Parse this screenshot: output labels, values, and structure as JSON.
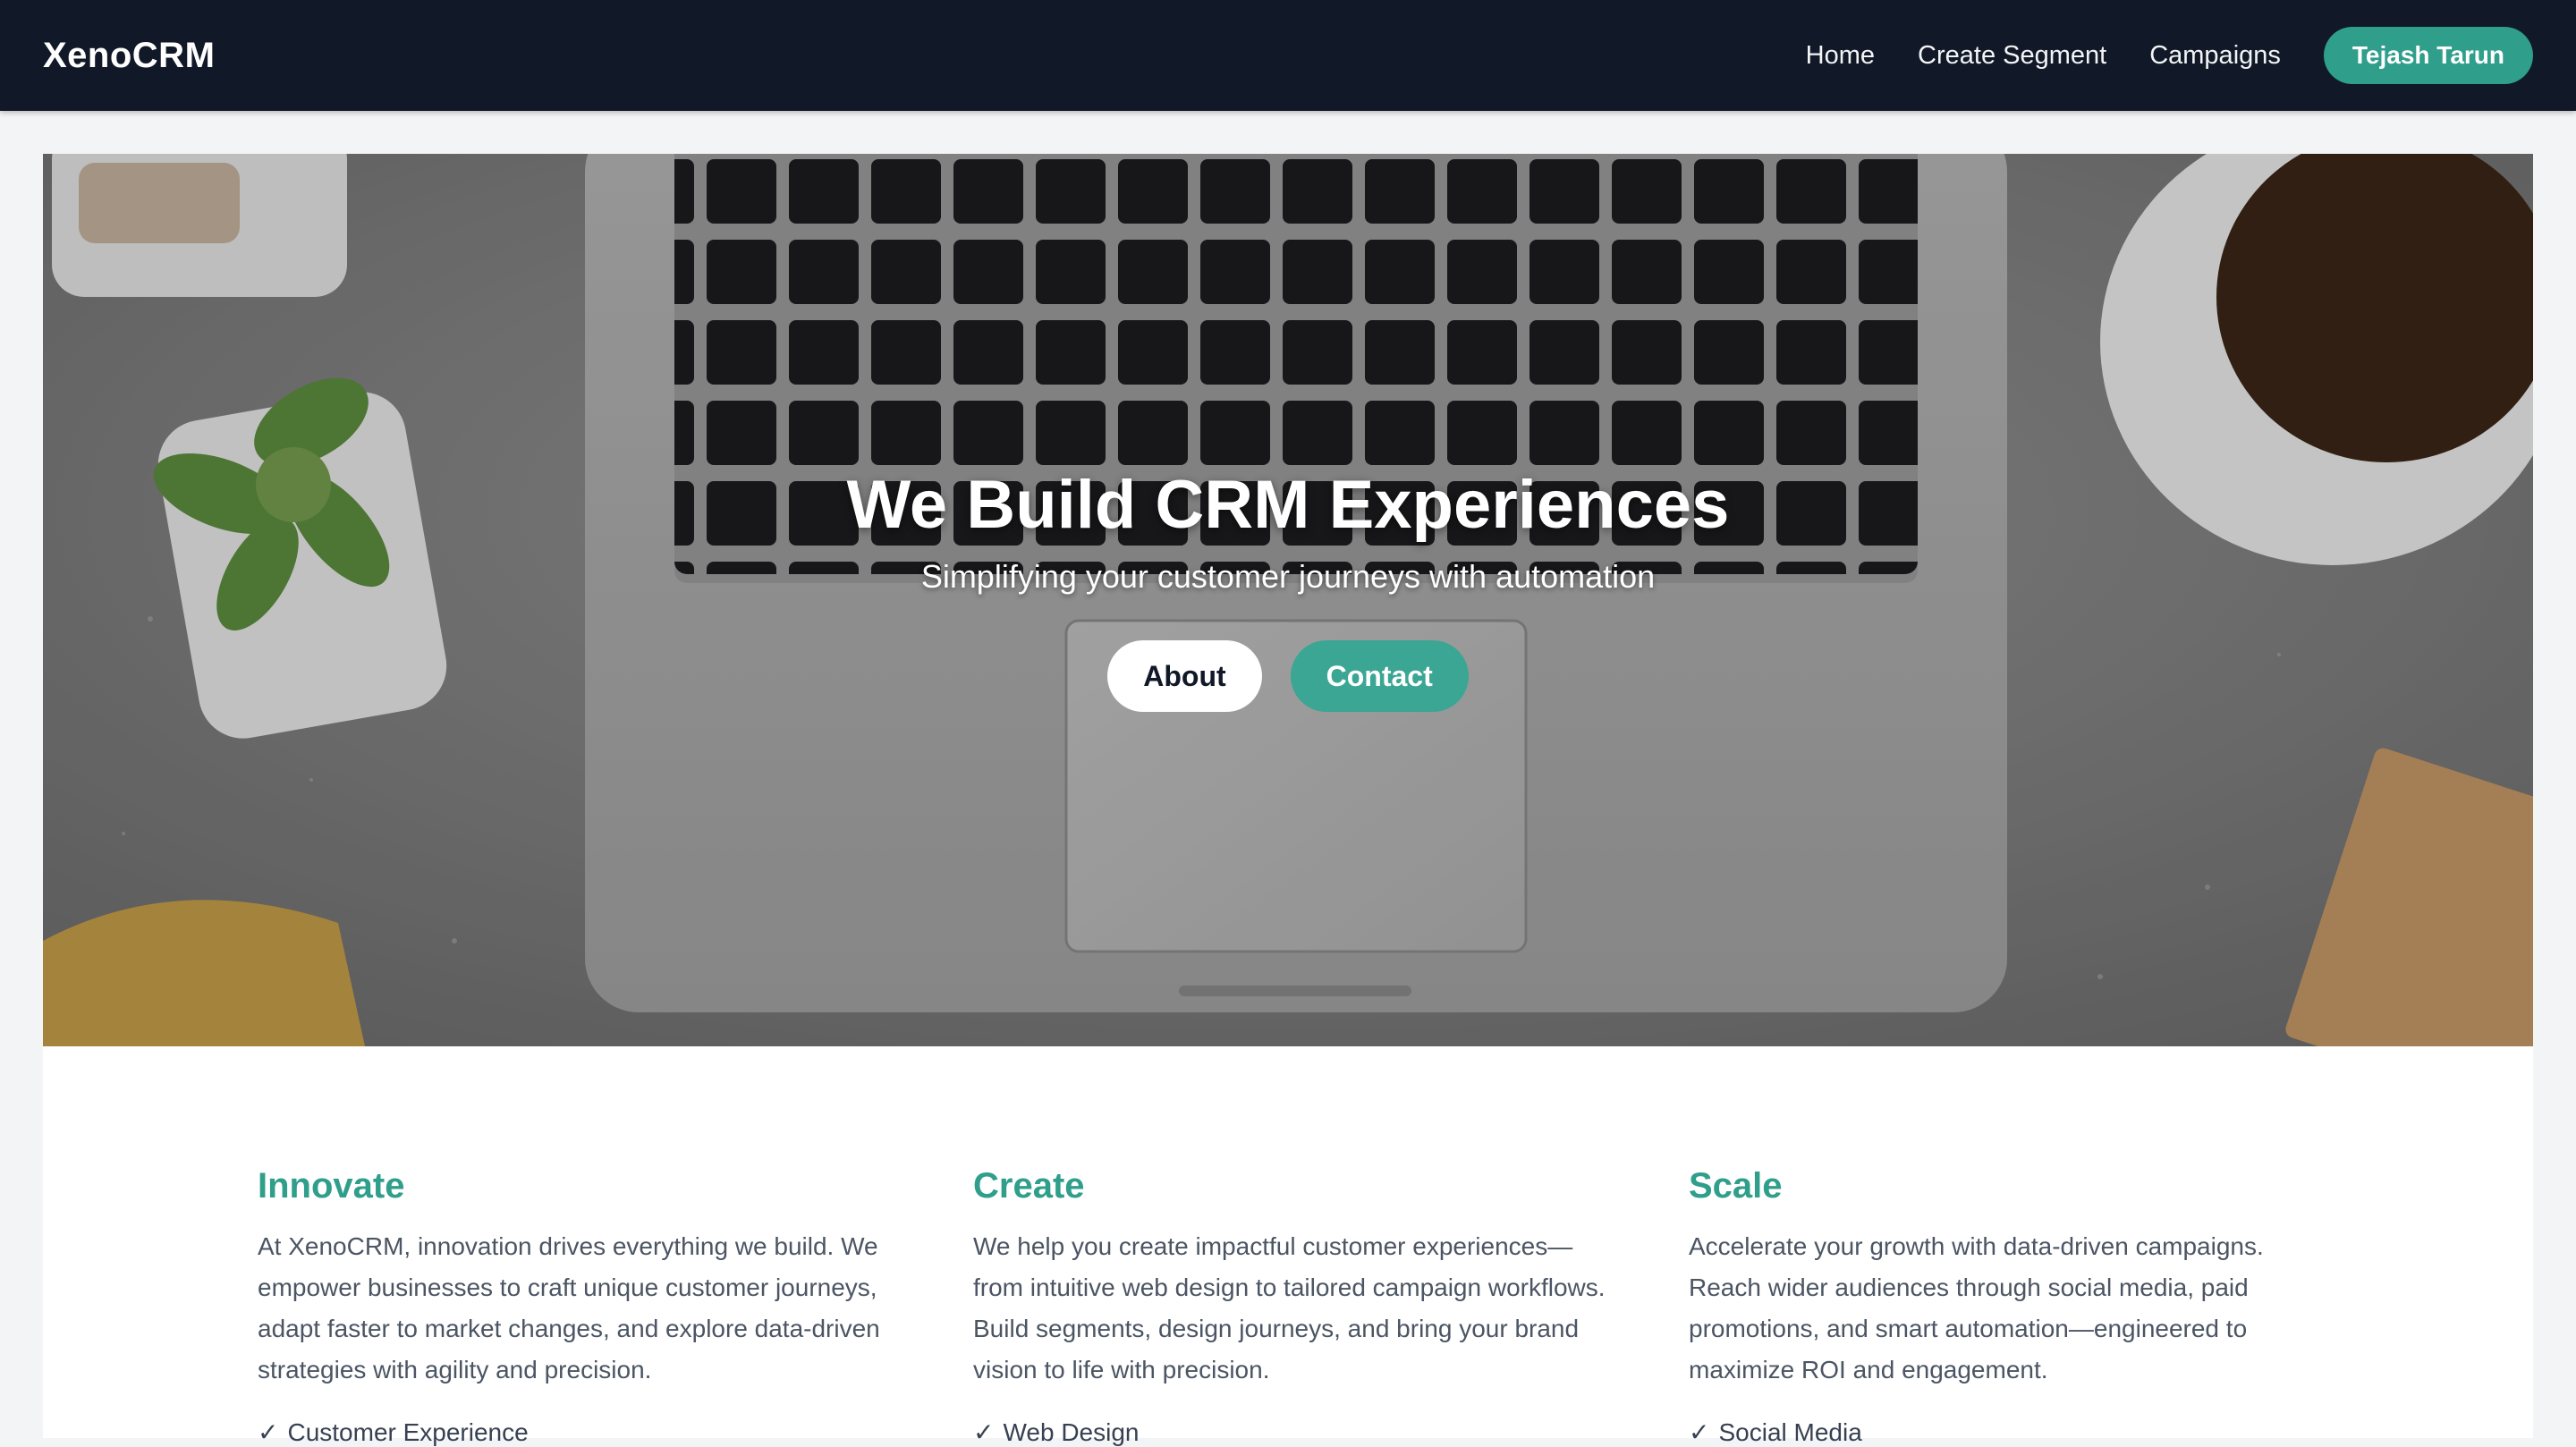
{
  "navbar": {
    "brand": "XenoCRM",
    "links": [
      "Home",
      "Create Segment",
      "Campaigns"
    ],
    "user": "Tejash Tarun"
  },
  "hero": {
    "title": "We Build CRM Experiences",
    "subtitle": "Simplifying your customer journeys with automation",
    "about_label": "About",
    "contact_label": "Contact"
  },
  "features": [
    {
      "title": "Innovate",
      "text": "At XenoCRM, innovation drives everything we build. We empower businesses to craft unique customer journeys, adapt faster to market changes, and explore data-driven strategies with agility and precision.",
      "item": "Customer Experience"
    },
    {
      "title": "Create",
      "text": "We help you create impactful customer experiences—from intuitive web design to tailored campaign workflows. Build segments, design journeys, and bring your brand vision to life with precision.",
      "item": "Web Design"
    },
    {
      "title": "Scale",
      "text": "Accelerate your growth with data-driven campaigns. Reach wider audiences through social media, paid promotions, and smart automation—engineered to maximize ROI and engagement.",
      "item": "Social Media"
    }
  ],
  "colors": {
    "navbar_bg": "#111827",
    "accent": "#2f9e8b",
    "contact_button": "#3aa693"
  },
  "icons": {
    "check": "check-icon"
  }
}
